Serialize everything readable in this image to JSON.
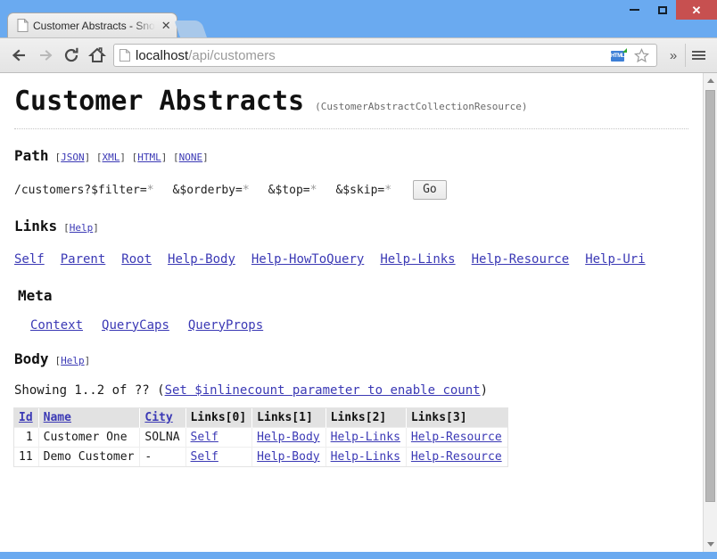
{
  "window": {
    "minimize_label": "",
    "maximize_label": "",
    "close_label": "✕"
  },
  "tab": {
    "title": "Customer Abstracts - Sno",
    "close_label": "✕"
  },
  "toolbar": {
    "back_label": "←",
    "forward_label": "→",
    "reload_label": "⟳",
    "home_label": "⌂",
    "url_host": "localhost",
    "url_path": "/api/customers",
    "html_badge_label": "HTML",
    "star_label": "☆",
    "overflow_label": "»"
  },
  "page": {
    "title": "Customer Abstracts",
    "subtitle": "(CustomerAbstractCollectionResource)",
    "path_section": {
      "heading": "Path",
      "formats": [
        "JSON",
        "XML",
        "HTML",
        "NONE"
      ],
      "query_parts": [
        {
          "text": "/customers?$filter=",
          "star": "*"
        },
        {
          "text": "&$orderby=",
          "star": "*"
        },
        {
          "text": "&$top=",
          "star": "*"
        },
        {
          "text": "&$skip=",
          "star": "*"
        }
      ],
      "go_label": "Go"
    },
    "links_section": {
      "heading": "Links",
      "help_label": "Help",
      "links": [
        "Self",
        "Parent",
        "Root",
        "Help-Body",
        "Help-HowToQuery",
        "Help-Links",
        "Help-Resource",
        "Help-Uri"
      ]
    },
    "meta_section": {
      "heading": "Meta",
      "links": [
        "Context",
        "QueryCaps",
        "QueryProps"
      ]
    },
    "body_section": {
      "heading": "Body",
      "help_label": "Help",
      "showing_prefix": "Showing 1..2 of ?? (",
      "showing_link": "Set $inlinecount parameter to enable count",
      "showing_suffix": ")",
      "table": {
        "columns": [
          {
            "label": "Id",
            "link": true
          },
          {
            "label": "Name",
            "link": true
          },
          {
            "label": "City",
            "link": true
          },
          {
            "label": "Links[0]",
            "link": false
          },
          {
            "label": "Links[1]",
            "link": false
          },
          {
            "label": "Links[2]",
            "link": false
          },
          {
            "label": "Links[3]",
            "link": false
          }
        ],
        "rows": [
          {
            "id": "1",
            "name": "Customer One",
            "city": "SOLNA",
            "links": [
              "Self",
              "Help-Body",
              "Help-Links",
              "Help-Resource"
            ]
          },
          {
            "id": "11",
            "name": "Demo Customer",
            "city": "-",
            "links": [
              "Self",
              "Help-Body",
              "Help-Links",
              "Help-Resource"
            ]
          }
        ]
      }
    }
  },
  "colors": {
    "frame": "#6aaaf0",
    "link": "#3b39b5",
    "id_green": "#1f8a1f",
    "close_red": "#c75050"
  }
}
